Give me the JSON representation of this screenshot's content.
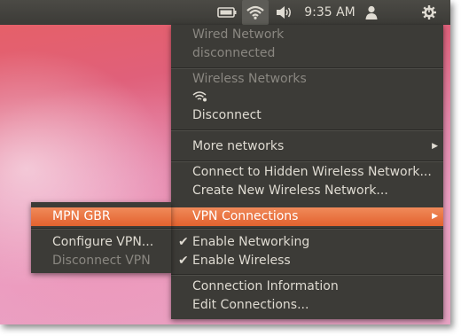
{
  "panel": {
    "clock": "9:35 AM",
    "icons": [
      "battery-icon",
      "wifi-icon",
      "volume-icon",
      "user-icon",
      "power-gear-icon"
    ]
  },
  "network_menu": {
    "wired_title": "Wired Network",
    "wired_status": "disconnected",
    "wireless_title": "Wireless Networks",
    "disconnect": "Disconnect",
    "more_networks": "More networks",
    "connect_hidden": "Connect to Hidden Wireless Network...",
    "create_new": "Create New Wireless Network...",
    "vpn_connections": "VPN Connections",
    "enable_networking": "Enable Networking",
    "enable_wireless": "Enable Wireless",
    "connection_info": "Connection Information",
    "edit_connections": "Edit Connections..."
  },
  "vpn_submenu": {
    "items": [
      "MPN GBR"
    ],
    "configure": "Configure VPN...",
    "disconnect": "Disconnect VPN"
  },
  "colors": {
    "panel": "#3c3b37",
    "menu": "#3c3b37",
    "highlight": "#e9713b",
    "text": "#dfdbd2",
    "disabled_text": "#8a8781"
  }
}
